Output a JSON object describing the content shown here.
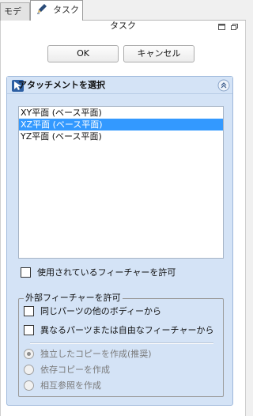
{
  "tabs": [
    {
      "label": "モデル",
      "active": false
    },
    {
      "label": "タスク",
      "active": true
    }
  ],
  "panel": {
    "title": "タスク",
    "ok_label": "OK",
    "cancel_label": "キャンセル"
  },
  "attachment": {
    "title": "アタッチメントを選択",
    "items": [
      {
        "label": "XY平面 (ベース平面)",
        "selected": false
      },
      {
        "label": "XZ平面 (ベース平面)",
        "selected": true
      },
      {
        "label": "YZ平面 (ベース平面)",
        "selected": false
      }
    ],
    "allow_used_label": "使用されているフィーチャーを許可",
    "allow_used_checked": false,
    "external": {
      "legend": "外部フィーチャーを許可",
      "same_part_label": "同じパーツの他のボディーから",
      "same_part_checked": false,
      "other_parts_label": "異なるパーツまたは自由なフィーチャーから",
      "other_parts_checked": false,
      "radios": [
        {
          "label": "独立したコピーを作成(推奨)",
          "checked": true
        },
        {
          "label": "依存コピーを作成",
          "checked": false
        },
        {
          "label": "相互参照を作成",
          "checked": false
        }
      ]
    }
  },
  "colors": {
    "selection": "#3399ff",
    "group_bg": "#d4e3f6"
  }
}
